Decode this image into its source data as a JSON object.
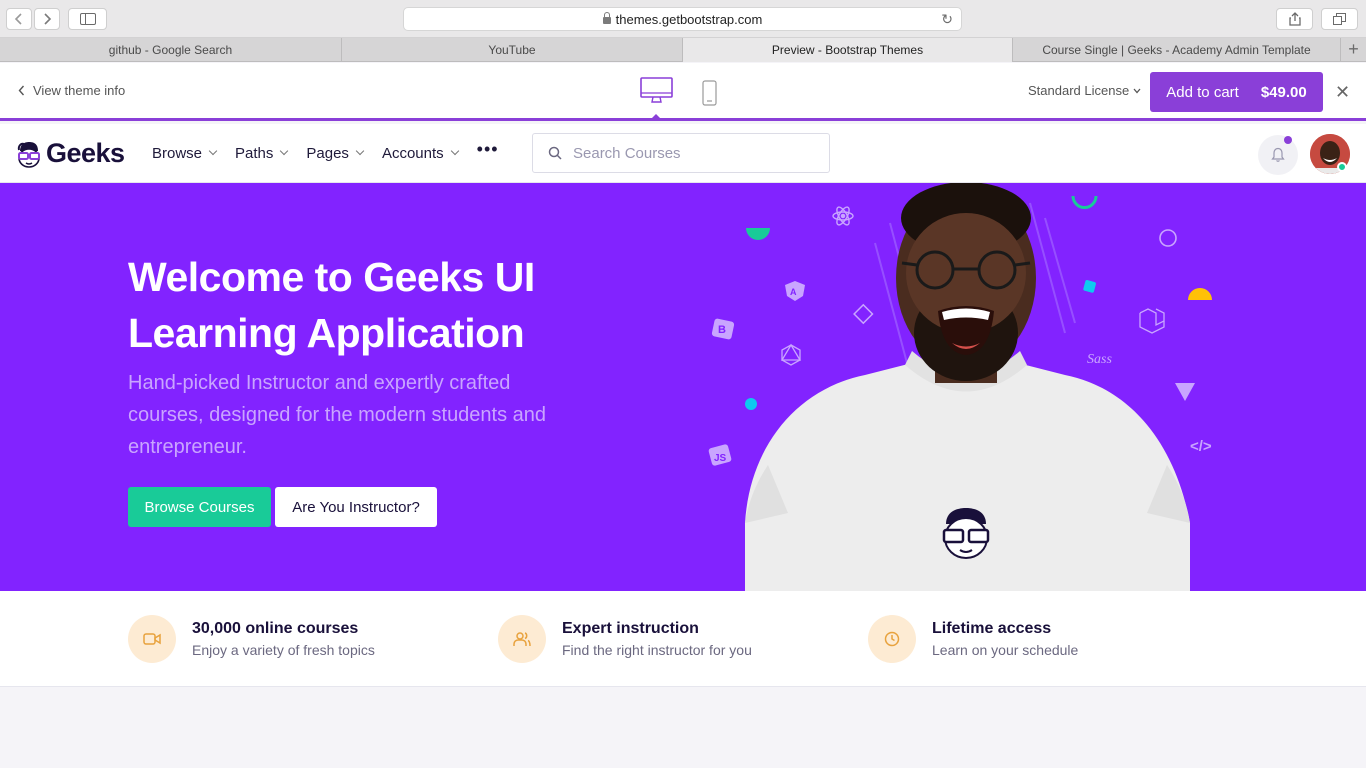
{
  "browser": {
    "url": "themes.getbootstrap.com",
    "tabs": [
      {
        "label": "github - Google Search"
      },
      {
        "label": "YouTube"
      },
      {
        "label": "Preview - Bootstrap Themes"
      },
      {
        "label": "Course Single | Geeks - Academy Admin Template"
      }
    ],
    "new_tab_label": "+"
  },
  "preview_bar": {
    "view_info_label": "View theme info",
    "license_label": "Standard License",
    "add_to_cart_label": "Add to cart",
    "price": "$49.00",
    "close_label": "✕"
  },
  "nav": {
    "logo_text": "Geeks",
    "menu": [
      {
        "label": "Browse"
      },
      {
        "label": "Paths"
      },
      {
        "label": "Pages"
      },
      {
        "label": "Accounts"
      }
    ],
    "more_label": "•••",
    "search_placeholder": "Search Courses"
  },
  "hero": {
    "title_line1": "Welcome to Geeks UI",
    "title_line2": "Learning Application",
    "subtitle": "Hand-picked Instructor and expertly crafted courses, designed for the modern students and entrepreneur.",
    "primary_button": "Browse Courses",
    "secondary_button": "Are You Instructor?",
    "background_color": "#8223ff"
  },
  "features": [
    {
      "title": "30,000 online courses",
      "desc": "Enjoy a variety of fresh topics",
      "icon": "video-icon"
    },
    {
      "title": "Expert instruction",
      "desc": "Find the right instructor for you",
      "icon": "users-icon"
    },
    {
      "title": "Lifetime access",
      "desc": "Learn on your schedule",
      "icon": "clock-icon"
    }
  ],
  "colors": {
    "accent": "#8a3fd8",
    "success": "#19cb98",
    "feature_icon_bg": "#fdebd3",
    "feature_icon_fg": "#e8a23d"
  }
}
